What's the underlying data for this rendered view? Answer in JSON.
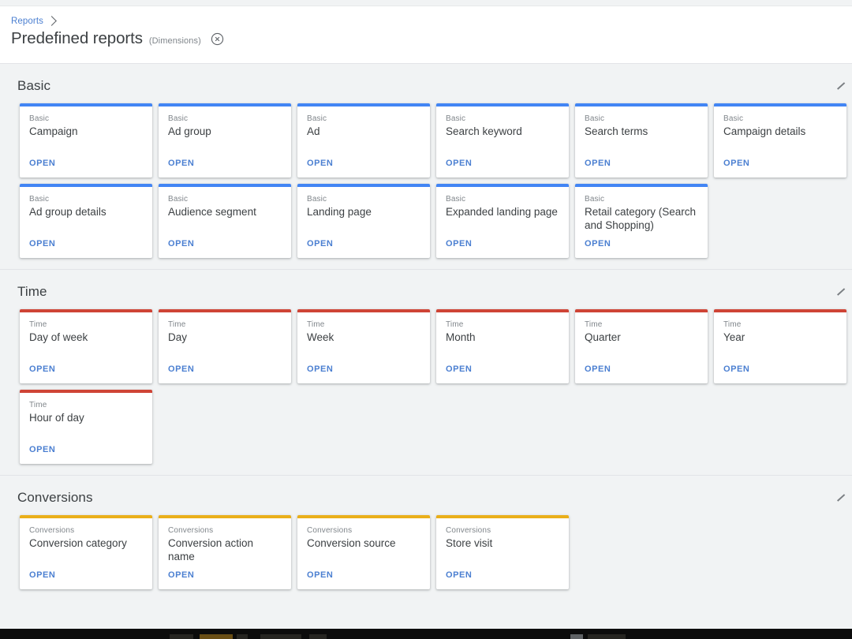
{
  "header": {
    "breadcrumb": "Reports",
    "breadcrumb_icon": "chevron-right-icon",
    "title": "Predefined reports",
    "subtitle": "(Dimensions)",
    "close_icon": "close-circle-icon"
  },
  "colors": {
    "basic_accent": "#4285f4",
    "time_accent": "#cf4436",
    "conversions_accent": "#eaaf1a",
    "link": "#4b7fd1",
    "page_background": "#f1f3f4",
    "card_background": "#ffffff",
    "title_text": "#3c4043",
    "muted_text": "#80868b"
  },
  "open_label": "OPEN",
  "collapse_icon": "collapse-chevron-icon",
  "sections": [
    {
      "id": "basic",
      "title": "Basic",
      "accent": "#4285f4",
      "cards": [
        {
          "category": "Basic",
          "title": "Campaign"
        },
        {
          "category": "Basic",
          "title": "Ad group"
        },
        {
          "category": "Basic",
          "title": "Ad"
        },
        {
          "category": "Basic",
          "title": "Search keyword"
        },
        {
          "category": "Basic",
          "title": "Search terms"
        },
        {
          "category": "Basic",
          "title": "Campaign details"
        },
        {
          "category": "Basic",
          "title": "Ad group details"
        },
        {
          "category": "Basic",
          "title": "Audience segment"
        },
        {
          "category": "Basic",
          "title": "Landing page"
        },
        {
          "category": "Basic",
          "title": "Expanded landing page"
        },
        {
          "category": "Basic",
          "title": "Retail category (Search and Shopping)"
        }
      ]
    },
    {
      "id": "time",
      "title": "Time",
      "accent": "#cf4436",
      "cards": [
        {
          "category": "Time",
          "title": "Day of week"
        },
        {
          "category": "Time",
          "title": "Day"
        },
        {
          "category": "Time",
          "title": "Week"
        },
        {
          "category": "Time",
          "title": "Month"
        },
        {
          "category": "Time",
          "title": "Quarter"
        },
        {
          "category": "Time",
          "title": "Year"
        },
        {
          "category": "Time",
          "title": "Hour of day"
        }
      ]
    },
    {
      "id": "conversions",
      "title": "Conversions",
      "accent": "#eaaf1a",
      "cards": [
        {
          "category": "Conversions",
          "title": "Conversion category"
        },
        {
          "category": "Conversions",
          "title": "Conversion action name"
        },
        {
          "category": "Conversions",
          "title": "Conversion source"
        },
        {
          "category": "Conversions",
          "title": "Store visit"
        }
      ]
    }
  ]
}
